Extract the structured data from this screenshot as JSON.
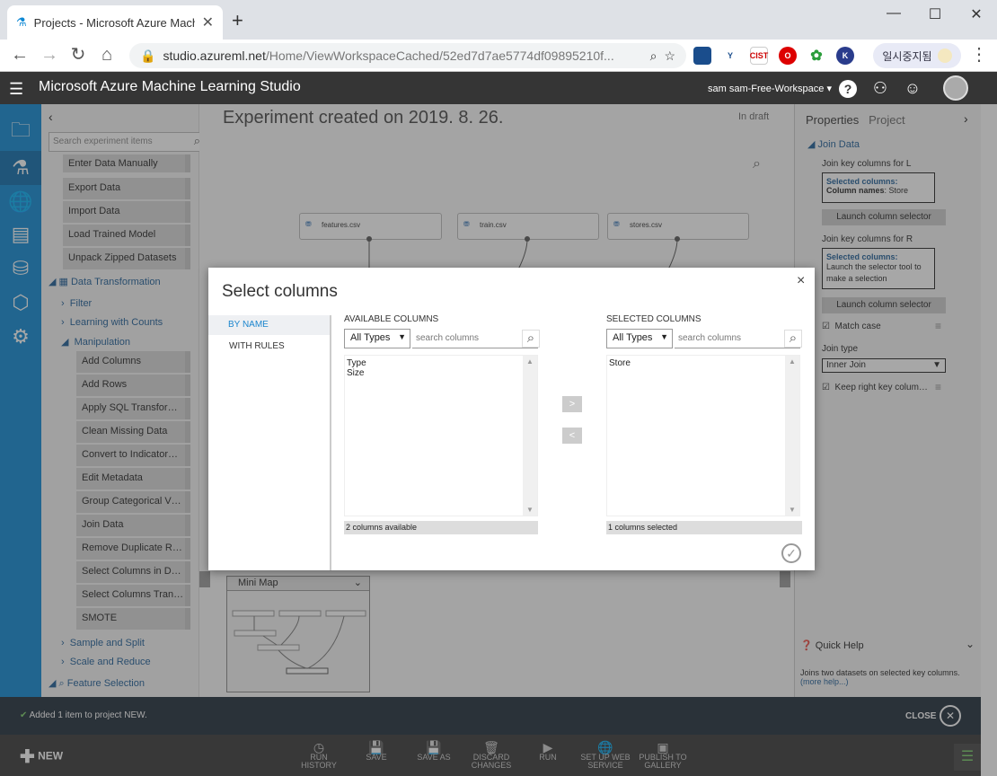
{
  "browser": {
    "tab_title": "Projects - Microsoft Azure Mach",
    "url_host": "studio.azureml.net",
    "url_path": "/Home/ViewWorkspaceCached/52ed7d7ae5774df09895210f...",
    "pause_label": "일시중지됨"
  },
  "app": {
    "title": "Microsoft Azure Machine Learning Studio",
    "workspace": "sam sam-Free-Workspace"
  },
  "palette": {
    "search_placeholder": "Search experiment items",
    "data_io": [
      "Enter Data Manually",
      "Export Data",
      "Import Data",
      "Load Trained Model",
      "Unpack Zipped Datasets"
    ],
    "data_transformation": "Data Transformation",
    "filter": "Filter",
    "learning_with_counts": "Learning with Counts",
    "manipulation": "Manipulation",
    "manip_items": [
      "Add Columns",
      "Add Rows",
      "Apply SQL Transfor…",
      "Clean Missing Data",
      "Convert to Indicator…",
      "Edit Metadata",
      "Group Categorical V…",
      "Join Data",
      "Remove Duplicate R…",
      "Select Columns in D…",
      "Select Columns Tran…",
      "SMOTE"
    ],
    "sample_split": "Sample and Split",
    "scale_reduce": "Scale and Reduce",
    "feature_selection": "Feature Selection"
  },
  "canvas": {
    "experiment_title": "Experiment created on 2019. 8. 26.",
    "status": "In draft",
    "nodes": [
      "features.csv",
      "train.csv",
      "stores.csv"
    ],
    "minimap_label": "Mini Map"
  },
  "properties": {
    "tab_properties": "Properties",
    "tab_project": "Project",
    "section": "Join Data",
    "join_key_l_label": "Join key columns for L",
    "l_selected_title": "Selected columns:",
    "l_column_names_label": "Column names",
    "l_column_names_value": "Store",
    "launch_selector": "Launch column selector",
    "join_key_r_label": "Join key columns for R",
    "r_selected_title": "Selected columns:",
    "r_hint": "Launch the selector tool to make a selection",
    "match_case": "Match case",
    "join_type_label": "Join type",
    "join_type_value": "Inner Join",
    "keep_right": "Keep right key colum…",
    "quick_help": "Quick Help",
    "help_text": "Joins two datasets on selected key columns.",
    "more_help": "(more help...)"
  },
  "notification": {
    "text": "Added 1 item to project NEW.",
    "close": "CLOSE"
  },
  "toolbar": {
    "new": "NEW",
    "buttons": [
      {
        "l1": "RUN",
        "l2": "HISTORY"
      },
      {
        "l1": "SAVE",
        "l2": ""
      },
      {
        "l1": "SAVE AS",
        "l2": ""
      },
      {
        "l1": "DISCARD",
        "l2": "CHANGES"
      },
      {
        "l1": "RUN",
        "l2": ""
      },
      {
        "l1": "SET UP WEB",
        "l2": "SERVICE"
      },
      {
        "l1": "PUBLISH TO",
        "l2": "GALLERY"
      }
    ]
  },
  "modal": {
    "title": "Select columns",
    "by_name": "BY NAME",
    "with_rules": "WITH RULES",
    "available_header": "AVAILABLE COLUMNS",
    "selected_header": "SELECTED COLUMNS",
    "type_filter": "All Types",
    "search_placeholder": "search columns",
    "available_columns": [
      "Type",
      "Size"
    ],
    "selected_columns": [
      "Store"
    ],
    "available_footer": "2 columns available",
    "selected_footer": "1 columns selected",
    "add_arrow": ">",
    "remove_arrow": "<"
  }
}
